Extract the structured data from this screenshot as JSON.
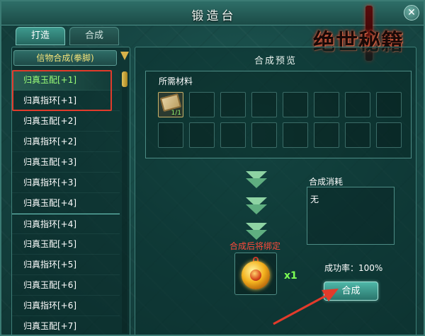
{
  "window": {
    "title": "锻造台",
    "close_symbol": "✕"
  },
  "logo": {
    "text": "绝世秘籍",
    "icon": "sword-logo-icon"
  },
  "tabs": [
    {
      "label": "打造",
      "active": true
    },
    {
      "label": "合成",
      "active": false
    }
  ],
  "category": {
    "label": "信物合成(拳脚)"
  },
  "list": {
    "items": [
      {
        "label": "归真玉配[+1]",
        "selected": true
      },
      {
        "label": "归真指环[+1]",
        "selected": false
      },
      {
        "label": "归真玉配[+2]",
        "selected": false
      },
      {
        "label": "归真指环[+2]",
        "selected": false
      },
      {
        "label": "归真玉配[+3]",
        "selected": false
      },
      {
        "label": "归真指环[+3]",
        "selected": false
      },
      {
        "label": "归真玉配[+4]",
        "selected": false
      },
      {
        "label": "归真指环[+4]",
        "selected": false
      },
      {
        "label": "归真玉配[+5]",
        "selected": false
      },
      {
        "label": "归真指环[+5]",
        "selected": false
      },
      {
        "label": "归真玉配[+6]",
        "selected": false
      },
      {
        "label": "归真指环[+6]",
        "selected": false
      },
      {
        "label": "归真玉配[+7]",
        "selected": false
      }
    ]
  },
  "preview": {
    "title": "合成预览",
    "materials_label": "所需材料",
    "material_item": {
      "icon": "scroll-icon",
      "count": "1/1"
    },
    "bind_note": "合成后将绑定",
    "result": {
      "icon": "amulet-icon",
      "quantity": "x1"
    },
    "cost_label": "合成消耗",
    "cost_value": "无",
    "success_rate": "成功率：100%",
    "synthesize_button": "合成"
  },
  "colors": {
    "highlight": "#e23b2b",
    "selected_text": "#9bff78",
    "bind_note": "#ff4a3a",
    "quantity": "#7dff54"
  }
}
